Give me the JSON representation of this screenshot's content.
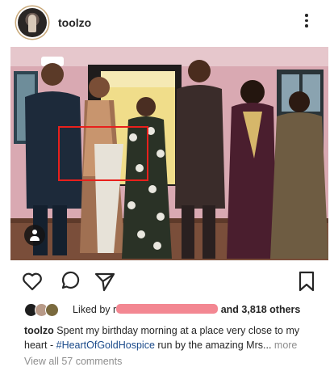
{
  "post": {
    "username": "toolzo",
    "avatar_icon": "profile-avatar",
    "more_icon": "more-vertical-icon"
  },
  "photo": {
    "description_icon": "photo",
    "has_highlight_box": true,
    "highlight_color": "#e8201c",
    "tag_icon": "user-tag-icon"
  },
  "actions": {
    "like_icon": "heart-icon",
    "comment_icon": "comment-icon",
    "share_icon": "paper-plane-icon",
    "save_icon": "bookmark-icon"
  },
  "likes": {
    "prefix": "Liked by",
    "name_start": "r",
    "suffix": "and 3,818 others",
    "redaction_color": "#f27a86"
  },
  "caption": {
    "username": "toolzo",
    "text_before": "Spent my birthday morning at a place very close to my heart -",
    "hashtag": "#HeartOfGoldHospice",
    "text_after": "run by the amazing Mrs...",
    "more_label": "more"
  },
  "comments": {
    "view_all_label": "View all 57 comments"
  }
}
